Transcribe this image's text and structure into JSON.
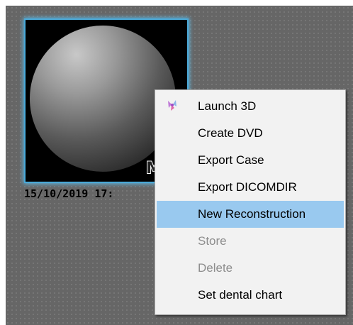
{
  "thumbnail": {
    "modality_label": "MA",
    "study_date": "15/10/2019 17:"
  },
  "context_menu": {
    "items": [
      {
        "label": "Launch 3D",
        "icon": "launch-3d-icon",
        "state": "normal"
      },
      {
        "label": "Create DVD",
        "state": "normal"
      },
      {
        "label": "Export Case",
        "state": "normal"
      },
      {
        "label": "Export DICOMDIR",
        "state": "normal"
      },
      {
        "label": "New Reconstruction",
        "state": "highlighted"
      },
      {
        "label": "Store",
        "state": "disabled"
      },
      {
        "label": "Delete",
        "state": "disabled"
      },
      {
        "label": "Set dental chart",
        "state": "normal"
      }
    ]
  },
  "colors": {
    "menu_highlight": "#99c9ef",
    "thumbnail_selection_glow": "#4aa9d8",
    "disabled_text": "#8d8d8d"
  }
}
